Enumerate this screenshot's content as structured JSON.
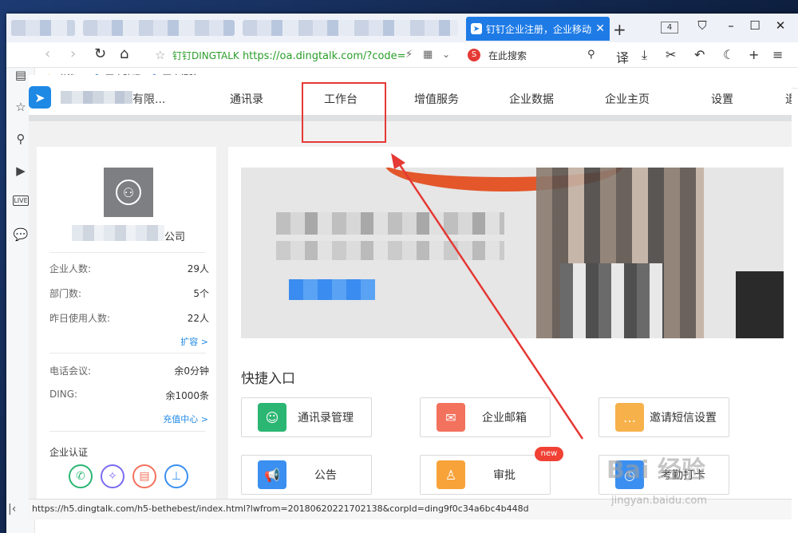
{
  "browser": {
    "active_tab_title": "钉钉企业注册，企业移动办",
    "tab_count": "4",
    "address_site": "钉钉DINGTALK",
    "address_url": "https://oa.dingtalk.com/?code=",
    "search_placeholder": "在此搜索",
    "bookmarks": [
      {
        "label": "书签",
        "icon": "star-icon"
      },
      {
        "label": "百度贴吧",
        "icon": "baidu-paw-icon"
      },
      {
        "label": "百度经验",
        "icon": "baidu-paw-icon"
      }
    ],
    "status_url": "https://h5.dingtalk.com/h5-bethebest/index.html?lwfrom=20180620221702138&corpId=ding9f0c34a6bc4b448d"
  },
  "topnav": {
    "company_suffix": "有限...",
    "items": [
      "通讯录",
      "工作台",
      "增值服务",
      "企业数据",
      "企业主页",
      "设置",
      "退"
    ]
  },
  "profile": {
    "name_suffix": "公司",
    "stats": [
      {
        "label": "企业人数:",
        "value": "29人"
      },
      {
        "label": "部门数:",
        "value": "5个"
      },
      {
        "label": "昨日使用人数:",
        "value": "22人"
      }
    ],
    "expand_link": "扩容 >",
    "stats2": [
      {
        "label": "电话会议:",
        "value": "余0分钟"
      },
      {
        "label": "DING:",
        "value": "余1000条"
      }
    ],
    "recharge_link": "充值中心 >",
    "cert_title": "企业认证"
  },
  "quick": {
    "title": "快捷入口",
    "items": [
      {
        "label": "通讯录管理",
        "color": "#2bb673",
        "icon": "contacts-icon"
      },
      {
        "label": "企业邮箱",
        "color": "#f2725e",
        "icon": "mail-icon"
      },
      {
        "label": "邀请短信设置",
        "color": "#f7b14a",
        "icon": "message-icon"
      },
      {
        "label": "公告",
        "color": "#3b8ff0",
        "icon": "megaphone-icon"
      },
      {
        "label": "审批",
        "color": "#f7a33a",
        "icon": "approval-icon"
      },
      {
        "label": "考勤打卡",
        "color": "#3b8ff0",
        "icon": "attendance-icon"
      }
    ],
    "new_badge": "new"
  },
  "watermark": {
    "text": "Bai 经验",
    "sub": "jingyan.baidu.com"
  }
}
